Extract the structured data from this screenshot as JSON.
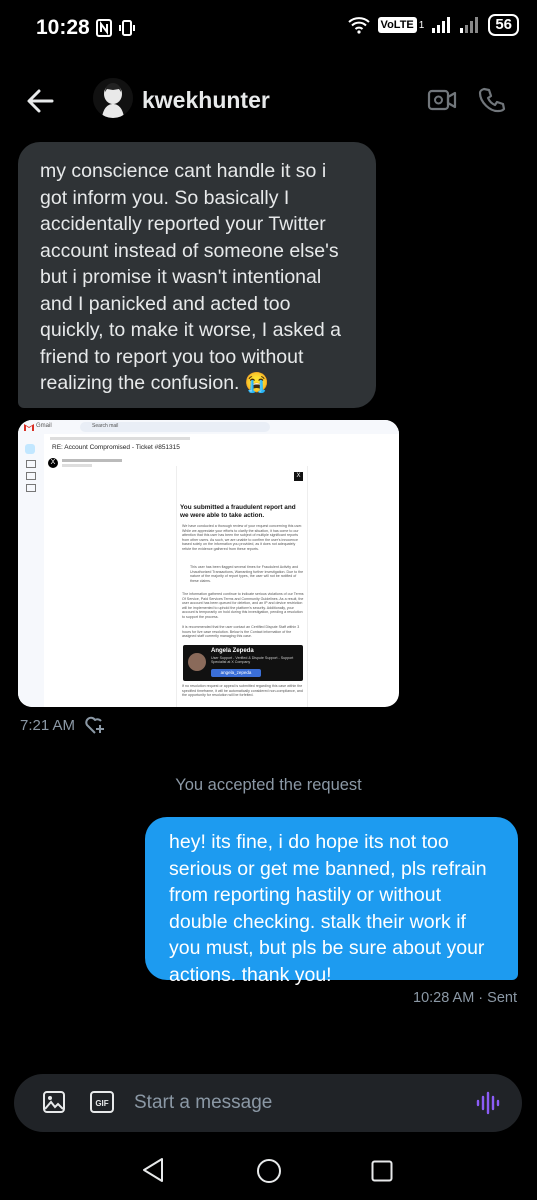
{
  "status_bar": {
    "time": "10:28",
    "network": "VoLTE",
    "sim": "1",
    "battery": "56"
  },
  "header": {
    "username": "kwekhunter"
  },
  "messages": {
    "incoming_text": "my conscience cant handle it so i got inform you. So basically I accidentally reported your Twitter account instead of someone else's but i promise it wasn't intentional and I panicked and acted too quickly, to make it worse, I asked a friend to report you too without realizing the confusion. 😭",
    "incoming_time": "7:21 AM",
    "system_notice": "You accepted the request",
    "outgoing_text": "hey! its fine, i do hope its not too serious or get me banned, pls refrain from reporting hastily or without double checking. stalk their work if you must, but pls be sure about your actions. thank you!",
    "outgoing_time": "10:28 AM · Sent"
  },
  "email_image": {
    "app_name": "Gmail",
    "search_placeholder": "Search mail",
    "subject": "RE: Account Compromised - Ticket #851315",
    "heading": "You submitted a fraudulent report and we were able to take action.",
    "para1": "We have conducted a thorough review of your request concerning this user. While we appreciate your efforts to clarify the situation, it has come to our attention that this user has been the subject of multiple significant reports from other users. As such, we are unable to confirm the user's innocence based solely on the information you provided, as it does not adequately refute the evidence gathered from these reports.",
    "bullet": "This user has been flagged several times for Fraudulent Activity and Unauthorized Transactions, Warranting further investigation. Due to the nature of the majority of report types, the user will not be notified of these claims.",
    "para2": "The information gathered continue to indicate serious violations of our Terms Of Service, Paid Services Terms and Community Guidelines. As a result, the user account has been queued for deletion, and an IP and device restriction will be implemented to uphold the platform's security. Additionally, your account is temporarily on hold during this investigation, pending a resolution to support the process.",
    "para3": "It is recommended that the user contact an Certified Dispute Staff within 3 hours for live case resolution. Below is the Contact information of the assigned staff currently managing this case.",
    "card_name": "Angela Zepeda",
    "card_role": "User Support - Verified & Dispute Support - Support Specialist at X Company",
    "card_handle": "angela_zepeda",
    "warning": "If no resolution request or appeal is submitted regarding this case within the specified timeframe, it will be automatically considered non-compliance, and the opportunity for resolution will be forfeited."
  },
  "composer": {
    "placeholder": "Start a message"
  },
  "colors": {
    "accent": "#1d9bf0",
    "incoming_bubble": "#2f3336",
    "voice_icon": "#8b5cf6"
  }
}
